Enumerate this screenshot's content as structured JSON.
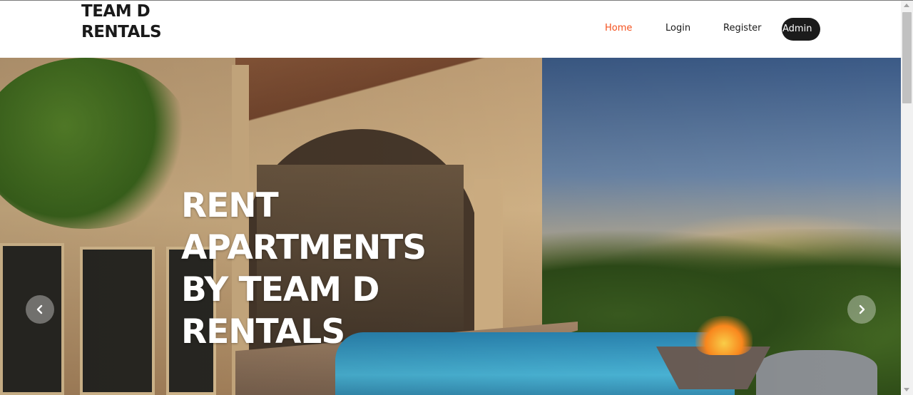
{
  "brand": {
    "line1": "TEAM D",
    "line2": "RENTALS"
  },
  "nav": {
    "items": [
      {
        "label": "Home",
        "active": true
      },
      {
        "label": "Login",
        "active": false
      },
      {
        "label": "Register",
        "active": false
      }
    ],
    "admin_label": "Admin",
    "active_color": "#f4511e"
  },
  "hero": {
    "title_lines": [
      "RENT",
      "APARTMENTS",
      "BY TEAM D",
      "RENTALS"
    ],
    "prev_icon": "chevron-left-icon",
    "next_icon": "chevron-right-icon"
  },
  "colors": {
    "admin_button": "#1b1b1b",
    "text": "#1a1a1a"
  }
}
